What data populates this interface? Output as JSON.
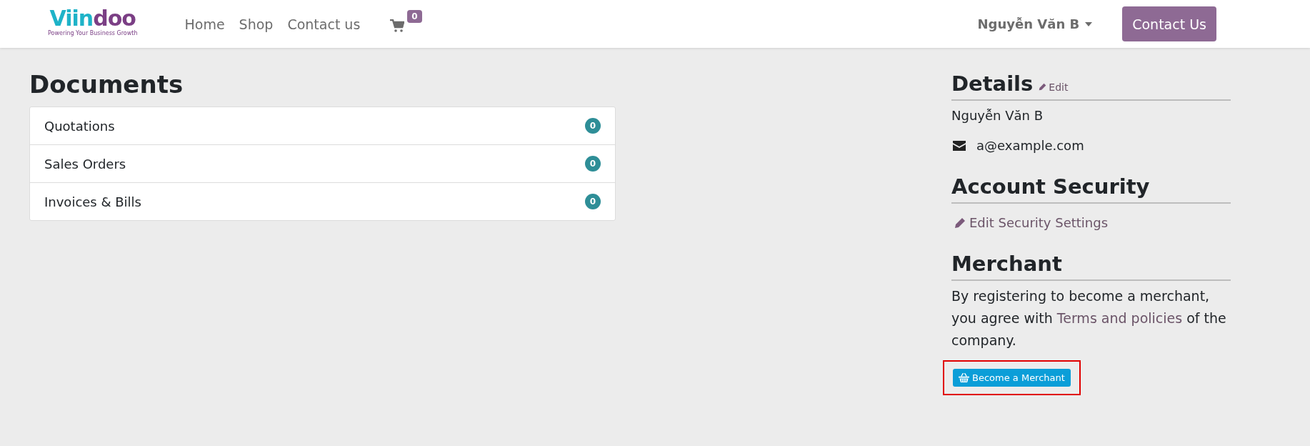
{
  "header": {
    "logo": {
      "parts": [
        {
          "text": "Viin",
          "color": "#1eb3c8"
        },
        {
          "text": "doo",
          "color": "#7b3f85"
        }
      ],
      "tagline": "Powering Your Business Growth"
    },
    "nav": [
      {
        "label": "Home"
      },
      {
        "label": "Shop"
      },
      {
        "label": "Contact us"
      }
    ],
    "cart_count": "0",
    "user": "Nguyễn Văn B",
    "contact_button": "Contact Us"
  },
  "documents": {
    "title": "Documents",
    "items": [
      {
        "label": "Quotations",
        "count": "0"
      },
      {
        "label": "Sales Orders",
        "count": "0"
      },
      {
        "label": "Invoices & Bills",
        "count": "0"
      }
    ]
  },
  "details": {
    "title": "Details",
    "edit": "Edit",
    "name": "Nguyễn Văn B",
    "email": "a@example.com"
  },
  "security": {
    "title": "Account Security",
    "link": "Edit Security Settings"
  },
  "merchant": {
    "title": "Merchant",
    "text_before": "By registering to become a merchant, you agree with",
    "link": "Terms and policies",
    "text_after": "of the company.",
    "button": "Become a Merchant",
    "highlighted": true
  }
}
